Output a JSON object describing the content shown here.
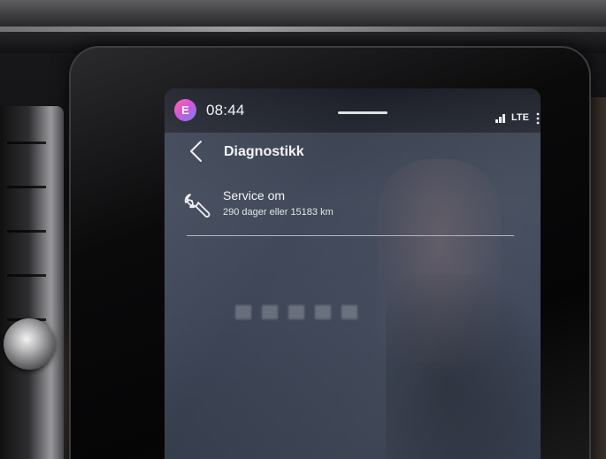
{
  "status_bar": {
    "profile_initial": "E",
    "time": "08:44",
    "network": "LTE",
    "signal_icon": "signal-strength-icon",
    "menu_icon": "more-vertical-icon"
  },
  "header": {
    "back_icon": "chevron-left-icon",
    "title": "Diagnostikk"
  },
  "service": {
    "icon": "wrench-icon",
    "title": "Service om",
    "detail": "290 dager eller 15183 km"
  },
  "colors": {
    "screen_background": "#404858",
    "status_bar_background": "#1f232c",
    "text_primary": "#f3f4f7",
    "divider": "#c7cbd3",
    "avatar_gradient_start": "#ff5fa2",
    "avatar_gradient_end": "#6b7cf2"
  }
}
